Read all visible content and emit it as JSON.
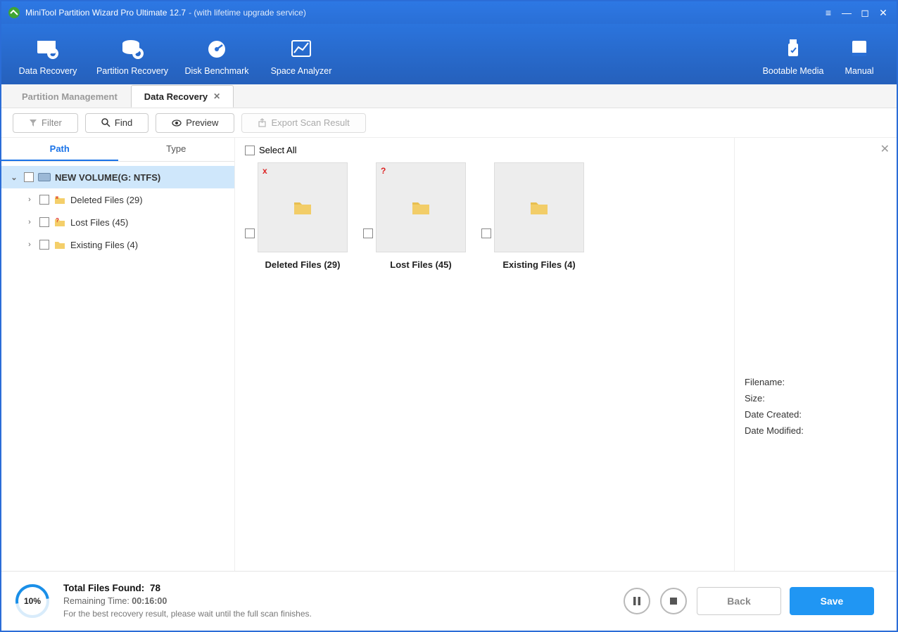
{
  "window": {
    "title_main": "MiniTool Partition Wizard Pro Ultimate 12.7",
    "title_sub": "- (with lifetime upgrade service)"
  },
  "ribbon": {
    "items": [
      {
        "label": "Data Recovery"
      },
      {
        "label": "Partition Recovery"
      },
      {
        "label": "Disk Benchmark"
      },
      {
        "label": "Space Analyzer"
      }
    ],
    "right": [
      {
        "label": "Bootable Media"
      },
      {
        "label": "Manual"
      }
    ]
  },
  "tabs": {
    "inactive": "Partition Management",
    "active": "Data Recovery"
  },
  "actions": {
    "filter": "Filter",
    "find": "Find",
    "preview": "Preview",
    "export": "Export Scan Result"
  },
  "subtabs": {
    "path": "Path",
    "type": "Type"
  },
  "tree": {
    "root": "NEW VOLUME(G: NTFS)",
    "children": [
      {
        "label": "Deleted Files (29)",
        "icon": "x"
      },
      {
        "label": "Lost Files (45)",
        "icon": "q"
      },
      {
        "label": "Existing Files (4)",
        "icon": "f"
      }
    ]
  },
  "content": {
    "select_all": "Select All",
    "cards": [
      {
        "label": "Deleted Files (29)",
        "badge": "x"
      },
      {
        "label": "Lost Files (45)",
        "badge": "q"
      },
      {
        "label": "Existing Files (4)",
        "badge": ""
      }
    ]
  },
  "details": {
    "filename": "Filename:",
    "size": "Size:",
    "created": "Date Created:",
    "modified": "Date Modified:"
  },
  "footer": {
    "percent": "10%",
    "total_label": "Total Files Found:",
    "total_value": "78",
    "remain_label": "Remaining Time:",
    "remain_value": "00:16:00",
    "hint": "For the best recovery result, please wait until the full scan finishes.",
    "back": "Back",
    "save": "Save"
  }
}
